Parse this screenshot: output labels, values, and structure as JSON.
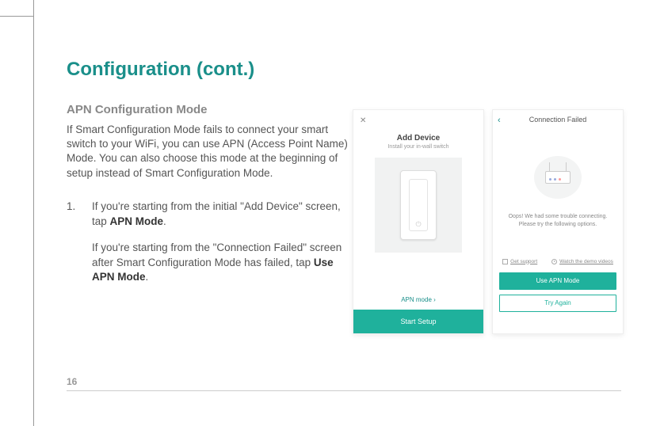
{
  "page": {
    "number": "16",
    "title": "Configuration (cont.)",
    "section_heading": "APN Configuration Mode",
    "section_body": "If Smart Configuration Mode fails to connect your smart switch to your WiFi, you can use APN (Access Point Name) Mode. You can also choose this mode at the beginning of setup instead of Smart Configuration Mode.",
    "step1_num": "1.",
    "step1_line1a": "If you're starting from the initial \"Add Device\" screen, tap ",
    "step1_line1b": "APN Mode",
    "step1_line1c": ".",
    "step1_line2a": "If you're starting from the \"Connection Failed\" screen after Smart Configuration Mode has failed, tap ",
    "step1_line2b": "Use APN Mode",
    "step1_line2c": "."
  },
  "phone_left": {
    "close": "✕",
    "title": "Add Device",
    "subtitle": "Install your in-wall switch",
    "apn_link": "APN mode ›",
    "start_btn": "Start Setup"
  },
  "phone_right": {
    "back": "‹",
    "header": "Connection Failed",
    "oops_line1": "Oops! We had some trouble connecting.",
    "oops_line2": "Please try the following options.",
    "help_support": "Get support",
    "help_video": "Watch the demo videos",
    "btn_use_apn": "Use APN Mode",
    "btn_try_again": "Try Again"
  }
}
